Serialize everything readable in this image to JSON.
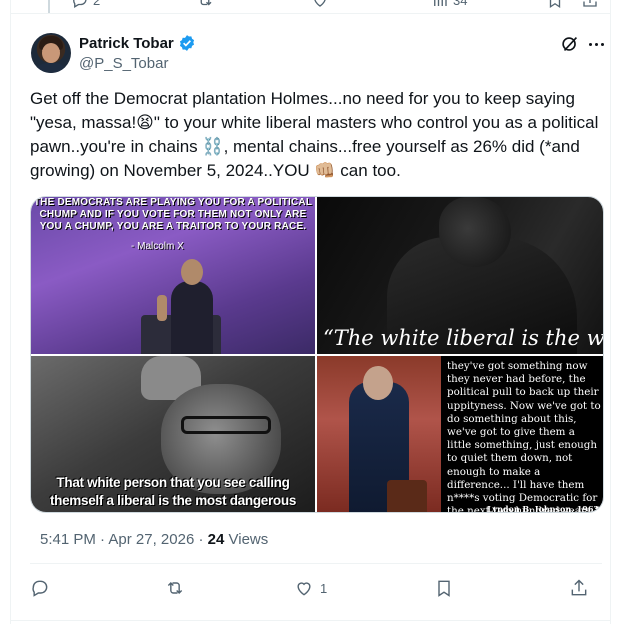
{
  "previous_post": {
    "reply_count": "2",
    "views_count": "34"
  },
  "author": {
    "name": "Patrick Tobar",
    "handle": "@P_S_Tobar",
    "verified": true
  },
  "tweet": {
    "text": "Get off the Democrat plantation Holmes...no need for you to keep saying \"yesa, massa!😫\" to your white liberal masters who control you as a political pawn..you're in chains ⛓️, mental chains...free yourself as 26% did (*and growing) on November 5, 2024..YOU 👊🏼 can too."
  },
  "media": {
    "image1": {
      "quote": "THE DEMOCRATS ARE PLAYING YOU FOR A POLITICAL CHUMP AND IF YOU VOTE FOR THEM NOT ONLY ARE YOU A CHUMP, YOU ARE A TRAITOR TO YOUR RACE.",
      "attribution": "- Malcolm X"
    },
    "image2": {
      "caption": "“The white liberal is the worst"
    },
    "image3": {
      "caption": "That white person that you see calling themself a liberal is the most dangerous"
    },
    "image4": {
      "quote": "they've got something now they never had before, the political pull to back up their uppityness. Now we've got to do something about this, we've got to give them a little something, just enough to quiet them down, not enough to make a difference... I'll have them n****s voting Democratic for the next two hundred years.”",
      "cite": "Lyndon B. Johnson, 1963"
    }
  },
  "meta": {
    "time": "5:41 PM",
    "separator": "·",
    "date": "Apr 27, 2026",
    "views_count": "24",
    "views_label": "Views"
  },
  "actions": {
    "reply_count": "",
    "repost_count": "",
    "like_count": "1"
  },
  "colors": {
    "text_primary": "#0f1419",
    "text_secondary": "#536471",
    "verified_blue": "#1d9bf0",
    "divider": "#eff3f4"
  }
}
